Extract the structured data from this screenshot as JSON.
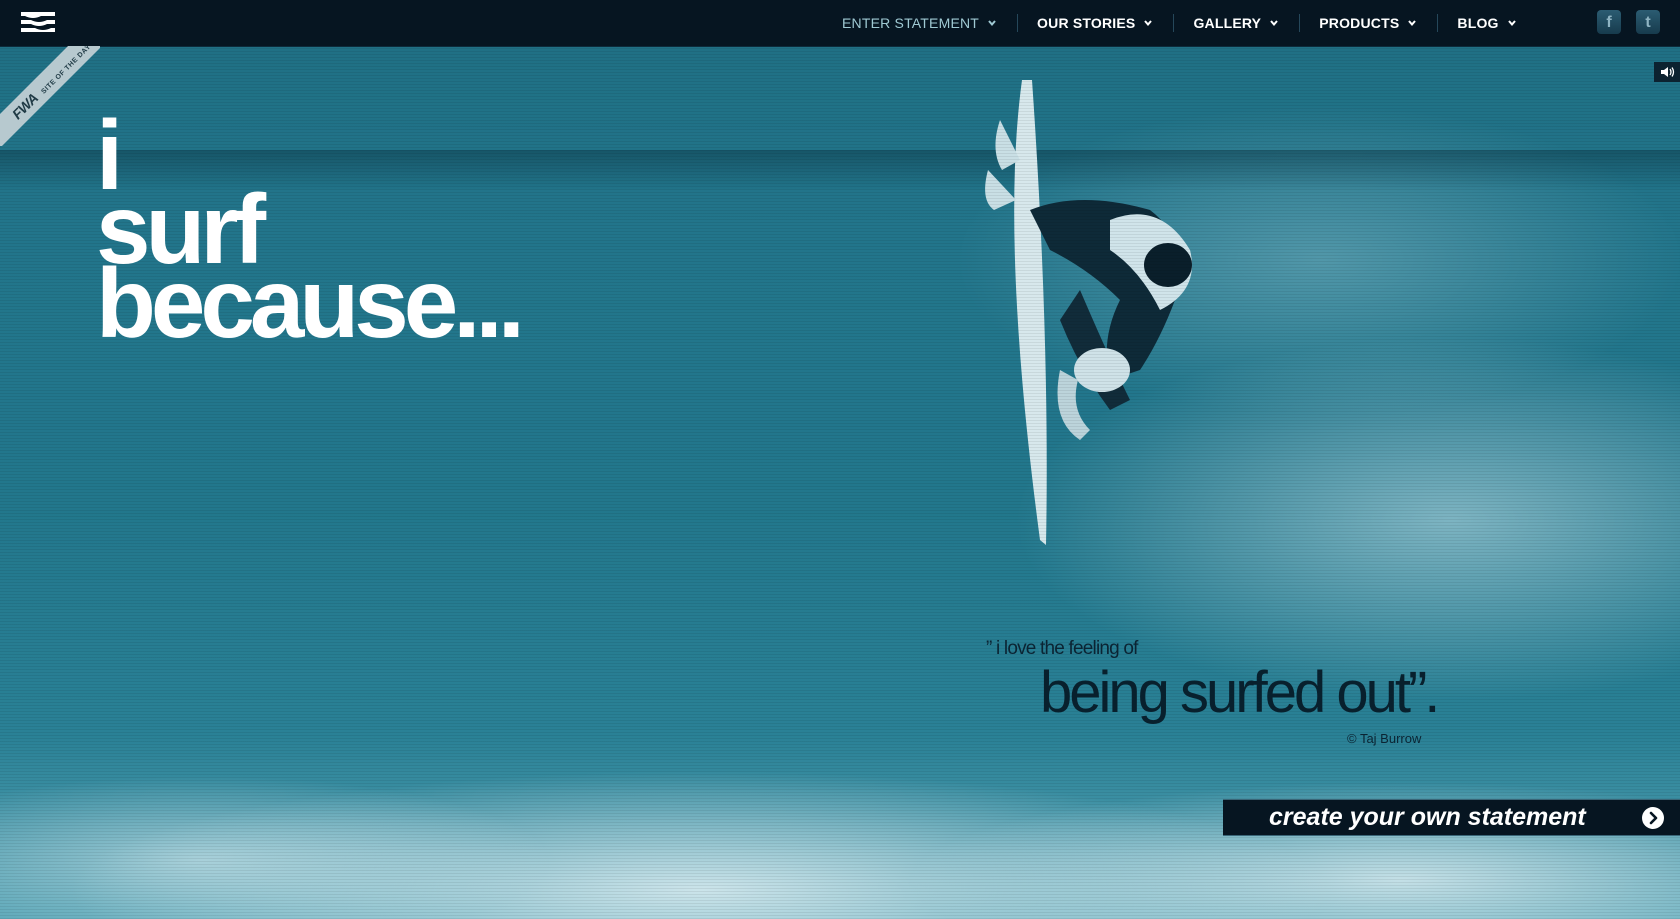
{
  "brand": {
    "logo_icon": "billabong-wave-logo"
  },
  "nav": {
    "items": [
      {
        "label": "ENTER STATEMENT",
        "active": true
      },
      {
        "label": "OUR STORIES",
        "active": false
      },
      {
        "label": "GALLERY",
        "active": false
      },
      {
        "label": "PRODUCTS",
        "active": false
      },
      {
        "label": "BLOG",
        "active": false
      }
    ],
    "social": {
      "facebook": "f",
      "twitter": "t"
    }
  },
  "award": {
    "logo": "FWA",
    "text": "SITE OF THE DAY"
  },
  "sound_icon": "speaker-icon",
  "headline": {
    "line1": "i",
    "line2": "surf",
    "line3": "because..."
  },
  "quote": {
    "intro": "” i love the feeling of",
    "main": "being surfed out”.",
    "credit": "© Taj Burrow"
  },
  "cta": {
    "label": "create your own statement"
  },
  "colors": {
    "nav_bg": "#061521",
    "nav_active": "#9fc9d3",
    "water": "#22778c",
    "quote_text": "#08202d"
  }
}
